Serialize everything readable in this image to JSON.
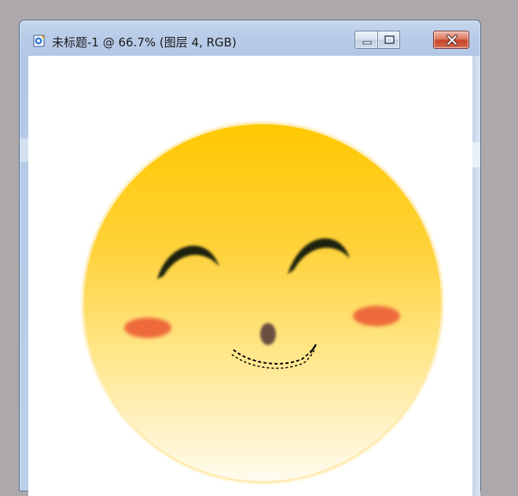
{
  "window": {
    "title": "未标题-1 @ 66.7% (图层 4, RGB)",
    "icons": {
      "app": "photoshop-document-icon",
      "minimize": "minimize-icon",
      "maximize": "maximize-icon",
      "close": "close-icon"
    }
  },
  "colors": {
    "face_top": "#ffc800",
    "face_bottom": "#fffbef",
    "eyes": "#1d2008",
    "cheeks": "#ee6a3b",
    "nose": "#6b5040",
    "close_button": "#c7452a"
  }
}
